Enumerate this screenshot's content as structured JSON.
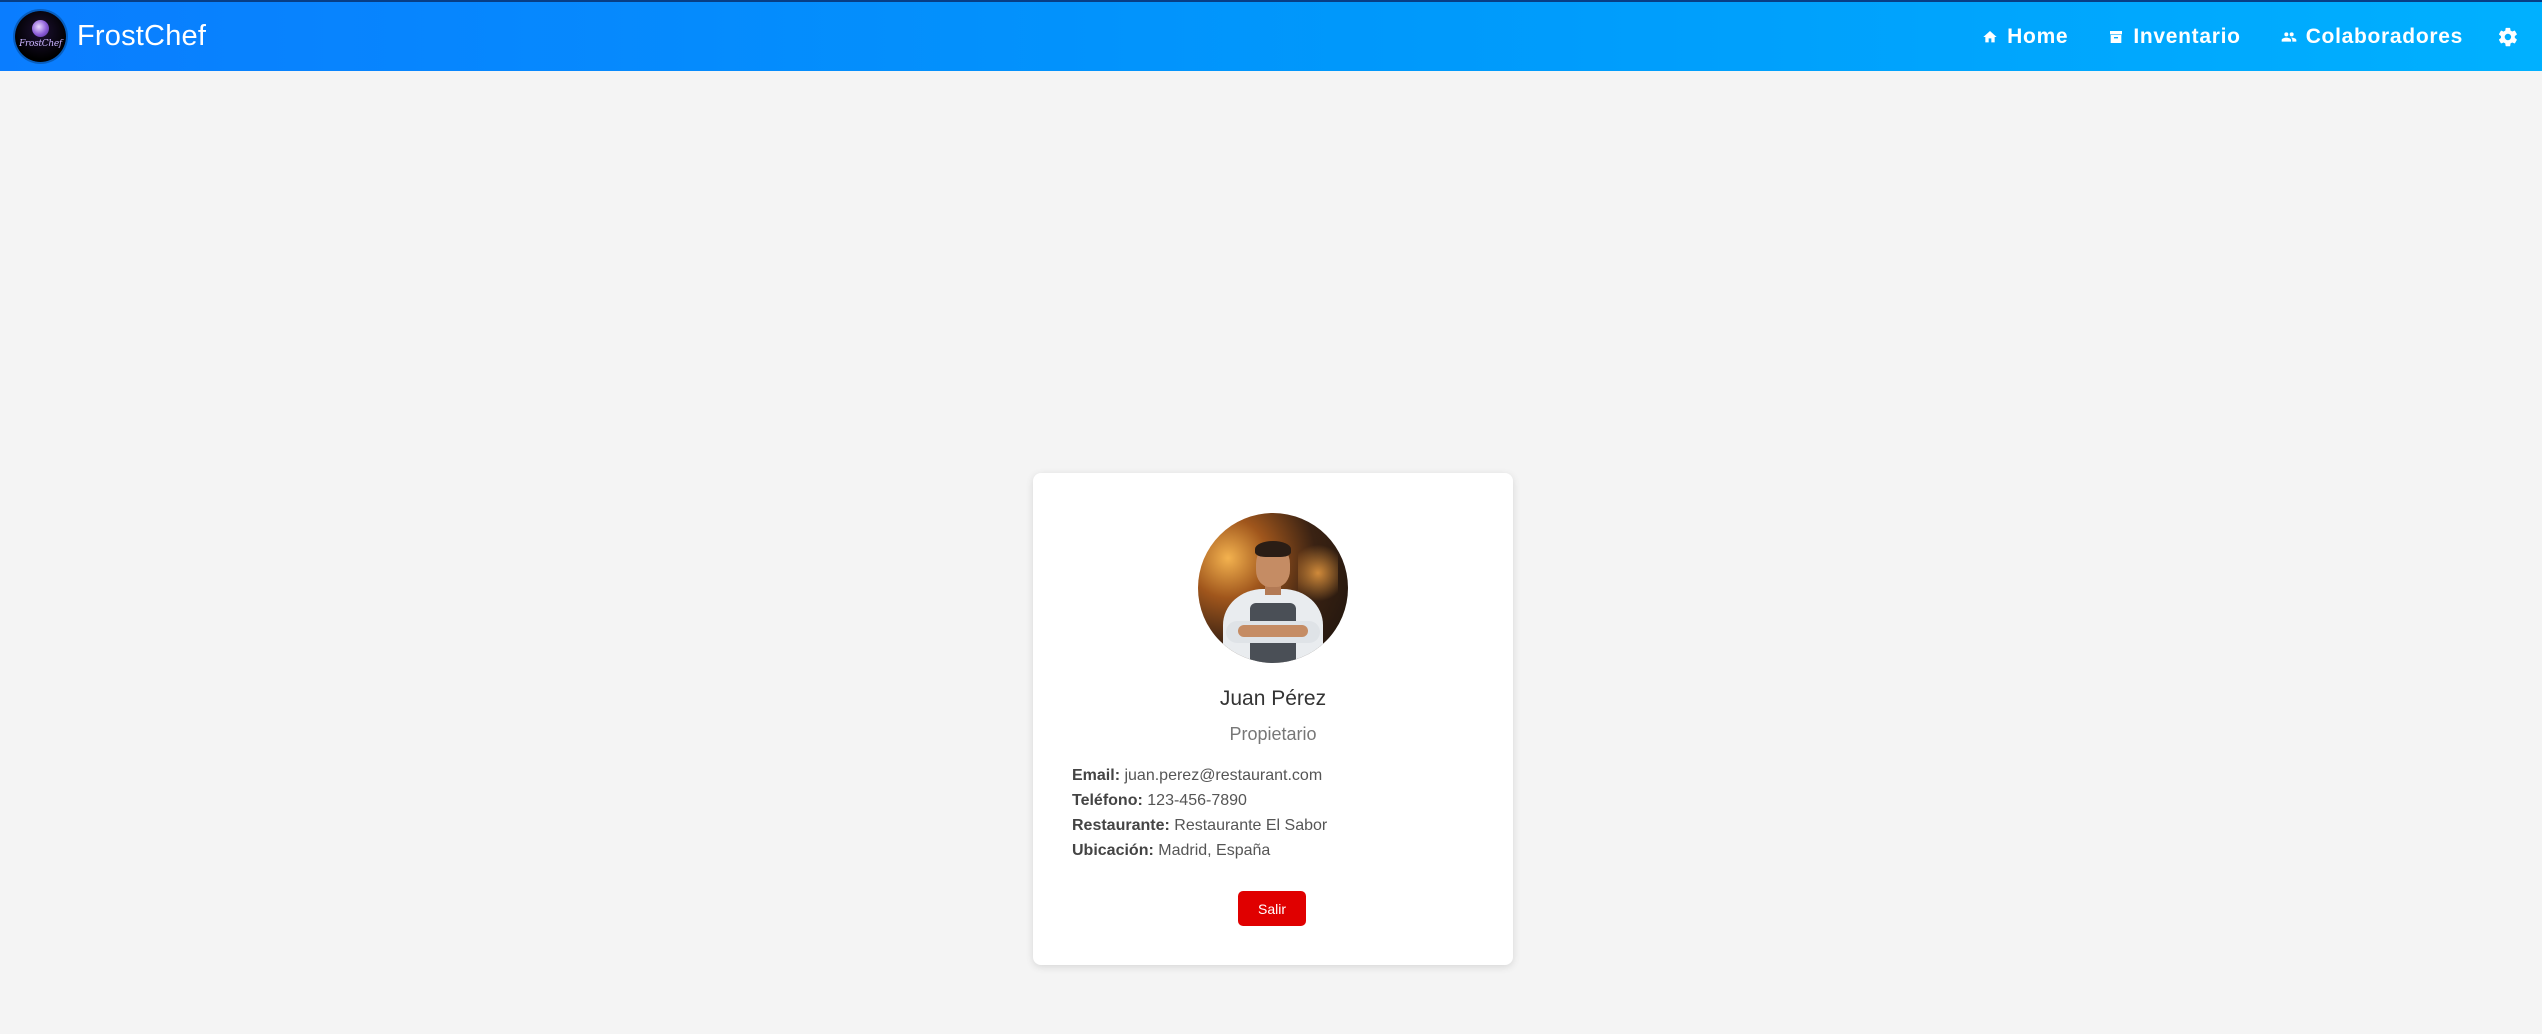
{
  "app": {
    "brand_name": "FrostChef",
    "logo_text": "FrostChef"
  },
  "nav": {
    "items": [
      {
        "label": "Home",
        "icon": "home-icon"
      },
      {
        "label": "Inventario",
        "icon": "archive-icon"
      },
      {
        "label": "Colaboradores",
        "icon": "group-icon"
      }
    ],
    "settings_icon": "gear-icon"
  },
  "colors": {
    "nav_gradient_start": "#0a7dff",
    "nav_gradient_end": "#00b0ff",
    "page_background": "#f4f4f4",
    "logout_button": "#e00000"
  },
  "profile": {
    "name": "Juan Pérez",
    "role": "Propietario",
    "details": [
      {
        "label": "Email:",
        "value": "juan.perez@restaurant.com"
      },
      {
        "label": "Teléfono:",
        "value": "123-456-7890"
      },
      {
        "label": "Restaurante:",
        "value": "Restaurante El Sabor"
      },
      {
        "label": "Ubicación:",
        "value": "Madrid, España"
      }
    ],
    "logout_label": "Salir"
  }
}
